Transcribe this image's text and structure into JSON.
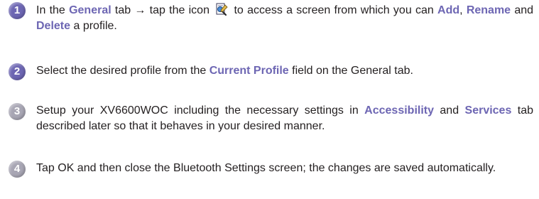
{
  "colors": {
    "accent": "#6d66b3",
    "badge_active": "#6d66b3",
    "badge_inactive": "#a8a6b4",
    "text": "#231f20"
  },
  "steps": [
    {
      "number": "1",
      "parts": {
        "p1": "In the ",
        "general": "General",
        "p2": " tab → tap the icon ",
        "icon": "profile-edit-icon",
        "p3": " to access a screen from which you can ",
        "add": "Add",
        "p4": ", ",
        "rename": "Rename",
        "p5": " and ",
        "delete": "Delete",
        "p6": " a profile."
      }
    },
    {
      "number": "2",
      "parts": {
        "p1": "Select the desired profile from the ",
        "current_profile": "Current Profile",
        "p2": " field on the General tab."
      }
    },
    {
      "number": "3",
      "parts": {
        "p1": "Setup your XV6600WOC including the necessary settings in ",
        "accessibility": "Accessibility",
        "p2": " and ",
        "services": "Services",
        "p3": " tab described later so that it behaves in your desired manner."
      }
    },
    {
      "number": "4",
      "parts": {
        "p1": "Tap OK and then close the Bluetooth Settings screen; the changes are saved automatically."
      }
    }
  ]
}
